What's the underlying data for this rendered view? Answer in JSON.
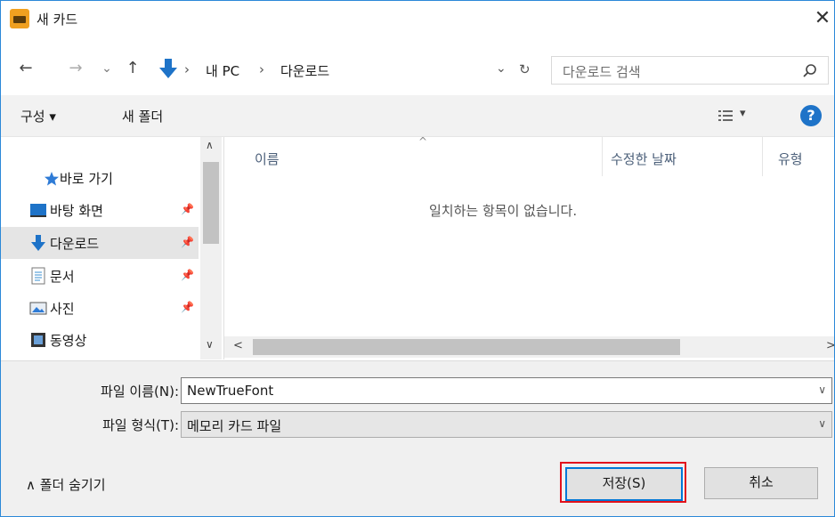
{
  "window": {
    "title": "새 카드",
    "close_glyph": "✕"
  },
  "nav": {
    "back": "←",
    "forward": "→",
    "recent": "⌄",
    "up": "↑",
    "crumbs": [
      "내 PC",
      "다운로드"
    ],
    "sep": "›",
    "dropdown": "⌄",
    "refresh": "↻",
    "search_placeholder": "다운로드 검색"
  },
  "toolbar": {
    "organize": "구성 ▾",
    "new_folder": "새 폴더",
    "view": "▾",
    "help": "?"
  },
  "sidebar": {
    "items": [
      {
        "label": "바로 가기",
        "icon": "star-icon"
      },
      {
        "label": "바탕 화면",
        "icon": "desktop-icon",
        "pin": "📌"
      },
      {
        "label": "다운로드",
        "icon": "download-icon",
        "pin": "📌",
        "selected": true
      },
      {
        "label": "문서",
        "icon": "document-icon",
        "pin": "📌"
      },
      {
        "label": "사진",
        "icon": "picture-icon",
        "pin": "📌"
      },
      {
        "label": "동영상",
        "icon": "video-icon"
      }
    ],
    "scroll_up": "∧",
    "scroll_down": "∨"
  },
  "files": {
    "columns": [
      "이름",
      "수정한 날짜",
      "유형"
    ],
    "sort_glyph": "^",
    "empty_message": "일치하는 항목이 없습니다.",
    "scroll_left": "<",
    "scroll_right": ">"
  },
  "form": {
    "filename_label": "파일 이름(N):",
    "filename_value": "NewTrueFont",
    "filetype_label": "파일 형식(T):",
    "filetype_value": "메모리 카드 파일",
    "chevron": "∨",
    "hide_folders": "∧  폴더 숨기기",
    "save": "저장(S)",
    "cancel": "취소"
  },
  "colors": {
    "accent": "#0078d7",
    "highlight": "#e2121c",
    "download_arrow": "#1e73c8"
  }
}
